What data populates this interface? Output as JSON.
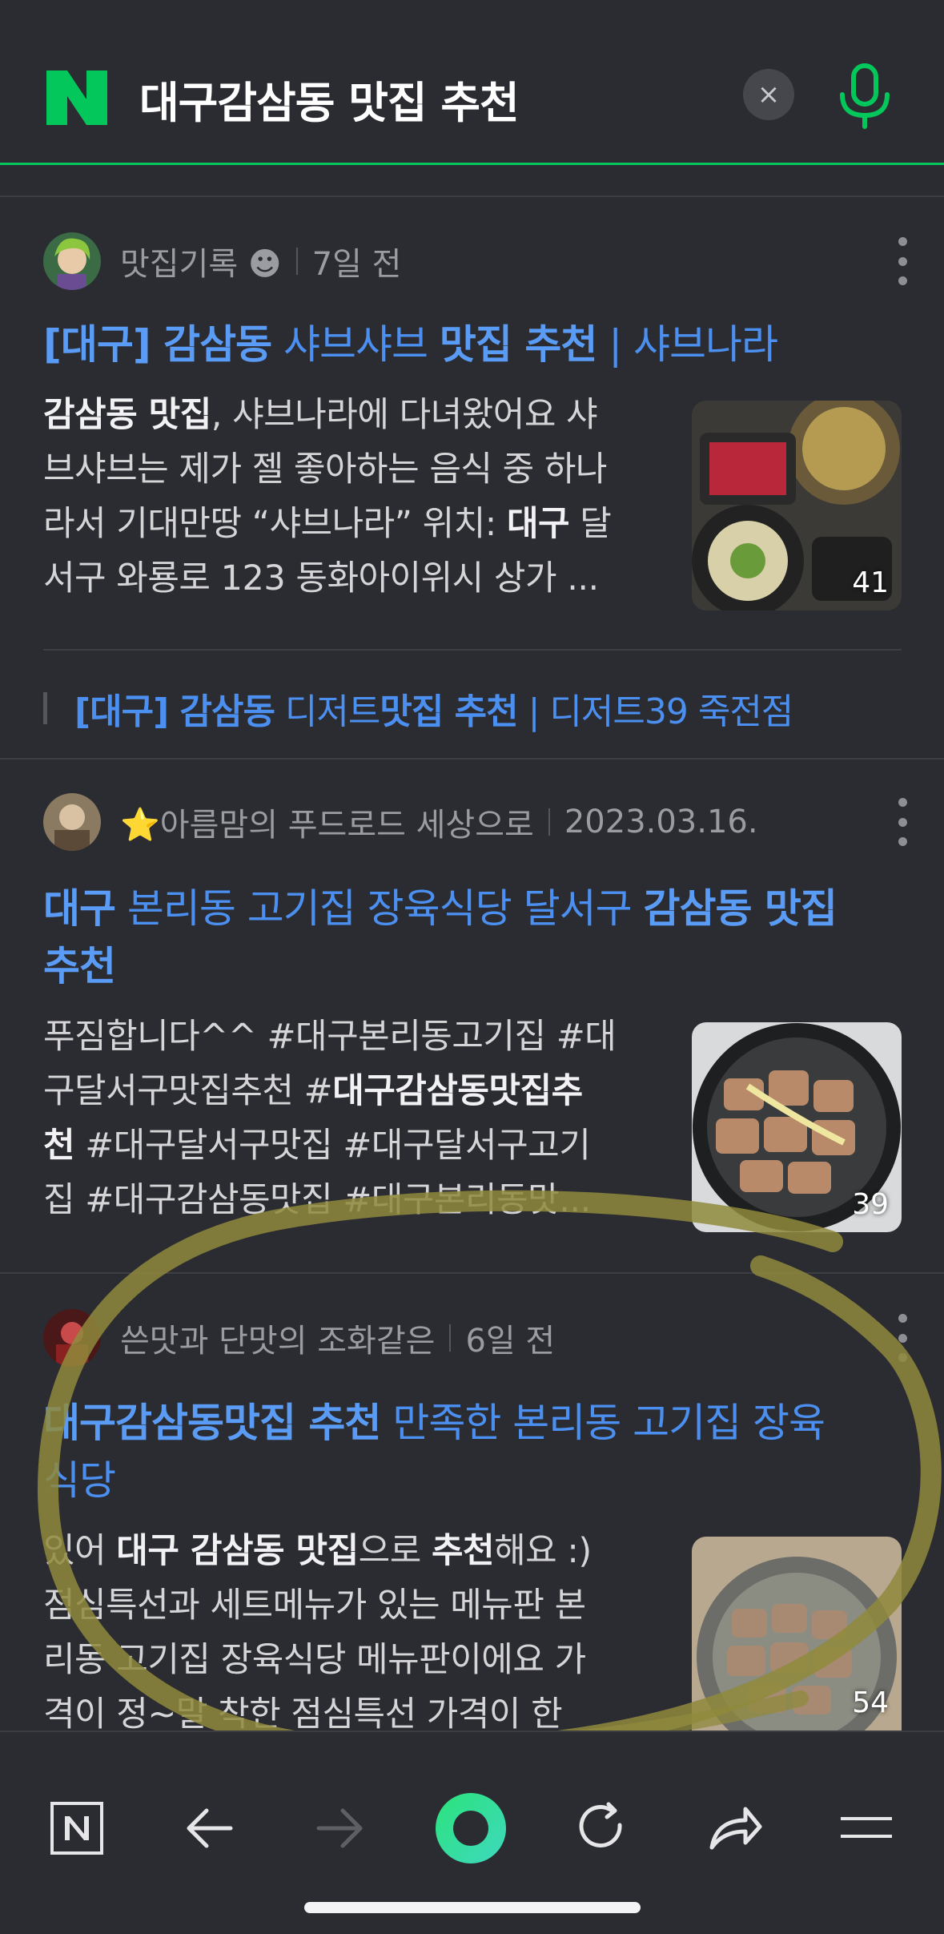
{
  "search": {
    "logo": "N",
    "query": "대구감삼동 맛집 추천",
    "clear_label": "×",
    "mic_icon": "microphone-icon"
  },
  "results": [
    {
      "author": "맛집기록 ☻",
      "date": "7일 전",
      "title_parts": [
        "[대구]",
        " 감삼동",
        " 샤브샤브 ",
        "맛집 추천",
        " | 샤브나라"
      ],
      "snippet_lines": [
        "감삼동 맛집, 샤브나라에 다녀왔어요 샤",
        "브샤브는 제가 젤 좋아하는 음식 중 하나",
        "라서 기대만땅 “샤브나라” 위치: 대구 달",
        "서구 와룡로 123 동화아이위시 상가 ..."
      ],
      "thumb_count": "41",
      "sub_link": "[대구] 감삼동 디저트맛집 추천 | 디저트39 죽전점"
    },
    {
      "author": "⭐아름맘의 푸드로드 세상으로",
      "date": "2023.03.16.",
      "title_line1": "대구 본리동 고기집 장육식당 달서구 감삼동 맛집",
      "title_line2": "추천",
      "snippet_lines": [
        "푸짐합니다^^ #대구본리동고기집 #대",
        "구달서구맛집추천 #대구감삼동맛집추",
        "천 #대구달서구맛집 #대구달서구고기",
        "집 #대구감삼동맛집 #대구본리동맛..."
      ],
      "thumb_count": "39"
    },
    {
      "author": "쓴맛과 단맛의 조화같은",
      "date": "6일 전",
      "title_line1": "대구감삼동맛집 추천 만족한 본리동 고기집 장육",
      "title_line2": "식당",
      "snippet_lines": [
        "있어 대구 감삼동 맛집으로 추천해요 :)",
        "점심특선과 세트메뉴가 있는 메뉴판 본",
        "리동 고기집 장육식당 메뉴판이에요 가",
        "격이 정~말 착한 점심특선 가격이 한"
      ],
      "thumb_count": "54"
    }
  ],
  "toolbar": {
    "items": [
      "naver-home-icon",
      "back-arrow-icon",
      "forward-arrow-icon",
      "green-dot-icon",
      "refresh-icon",
      "share-icon",
      "menu-icon"
    ]
  },
  "colors": {
    "brand_green": "#03c75a",
    "link_blue": "#4b8ff0",
    "background": "#2b2c31",
    "highlight_scribble": "#8a8a3a"
  }
}
